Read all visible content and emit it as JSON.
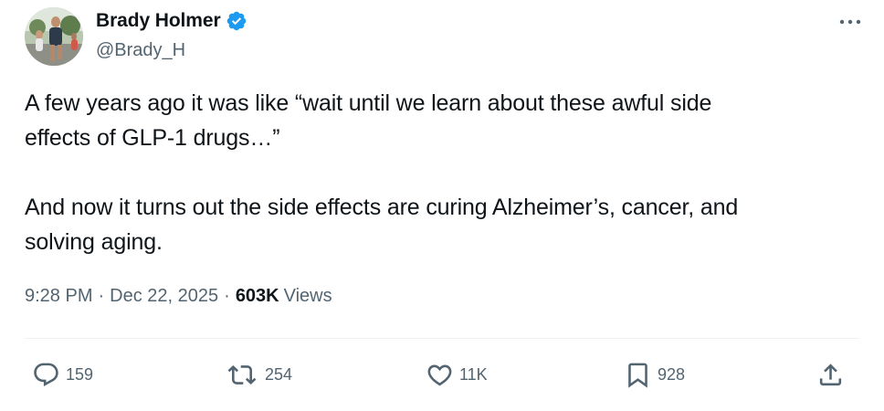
{
  "author": {
    "display_name": "Brady Holmer",
    "handle": "@Brady_H",
    "verified": true
  },
  "tweet": {
    "text": "A few years ago it was like “wait until we learn about these awful side\neffects of GLP-1 drugs…”\n\nAnd now it turns out the side effects are curing Alzheimer’s, cancer, and\nsolving aging.",
    "time": "9:28 PM",
    "separator": "·",
    "date": "Dec 22, 2025",
    "views_count": "603K",
    "views_label": "Views"
  },
  "actions": {
    "replies": "159",
    "reposts": "254",
    "likes": "11K",
    "bookmarks": "928"
  },
  "icons": {
    "more": "more-options-icon",
    "reply": "reply-icon",
    "repost": "repost-icon",
    "like": "like-icon",
    "bookmark": "bookmark-icon",
    "share": "share-icon",
    "verified": "verified-badge-icon"
  },
  "colors": {
    "text_primary": "#0f1419",
    "text_secondary": "#536471",
    "verified_blue": "#1d9bf0",
    "divider": "#eff3f4"
  }
}
